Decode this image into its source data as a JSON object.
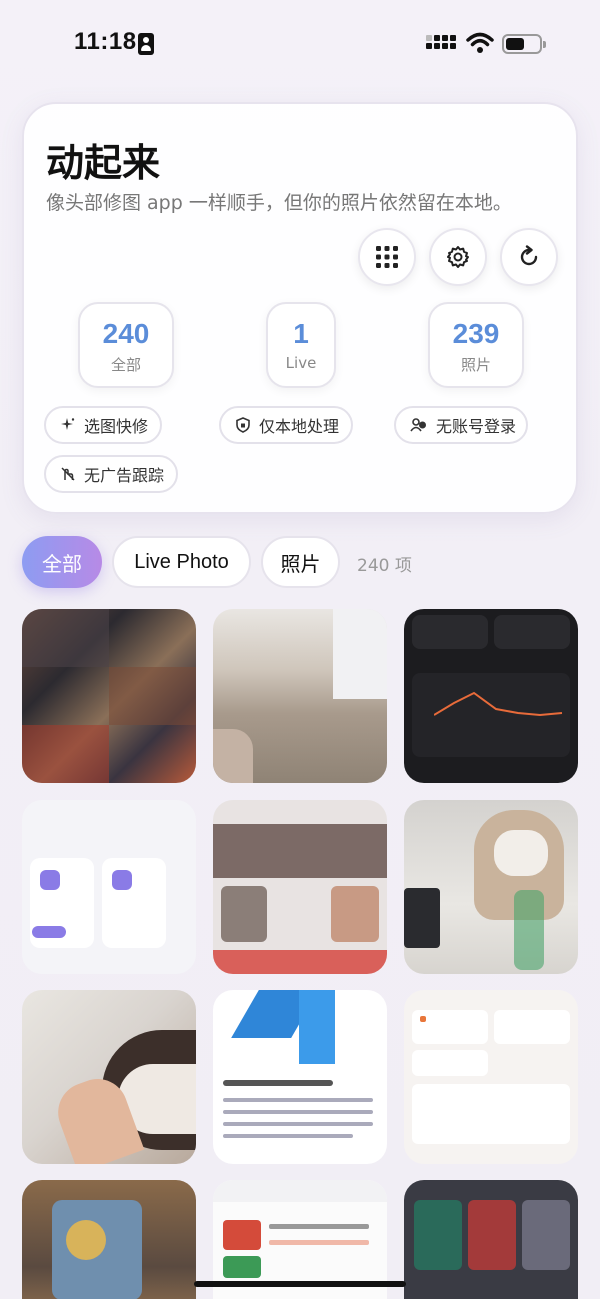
{
  "status_bar": {
    "time": "11:18"
  },
  "hero": {
    "title": "动起来",
    "subtitle": "像头部修图 app 一样顺手，但你的照片依然留在本地。",
    "buttons": {
      "grid": "grid-icon",
      "settings": "gear-icon",
      "refresh": "refresh-icon"
    },
    "stats": [
      {
        "value": "240",
        "label": "全部"
      },
      {
        "value": "1",
        "label": "Live"
      },
      {
        "value": "239",
        "label": "照片"
      }
    ],
    "chips": [
      "选图快修",
      "仅本地处理",
      "无账号登录",
      "无广告跟踪"
    ]
  },
  "filters": {
    "tabs": [
      "全部",
      "Live Photo",
      "照片"
    ],
    "active": "全部",
    "count": "240 项"
  },
  "grid": {
    "items": [
      "photo-collage",
      "photo-floor",
      "screenshot-chart",
      "screenshot-app",
      "screenshot-collage",
      "photo-cat",
      "photo-hand-cat",
      "screenshot-vscode",
      "screenshot-list",
      "photo-shelf",
      "screenshot-article",
      "screenshot-cards"
    ]
  },
  "colors": {
    "accent_start": "#8d9cf2",
    "accent_end": "#b78ae6",
    "stat_blue": "#5b8dd9"
  }
}
